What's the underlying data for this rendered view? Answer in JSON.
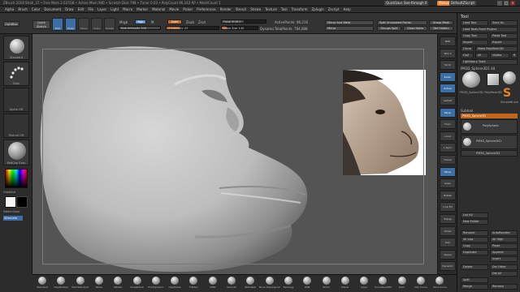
{
  "titlebar": {
    "title": "ZBrush 2018   Stroll_37  • Free Mem 2.637GB • Active Mem 940 • Scratch Disk 798 • Timer 0.03 • PolyCount 96.163 KP • MeshCount 1",
    "quicksave": "QuickSave",
    "seethrough": "See-through  0",
    "menus_btn": "Menus",
    "default_script": "DefaultZScript"
  },
  "menubar": [
    "Alpha",
    "Brush",
    "Color",
    "Document",
    "Draw",
    "Edit",
    "File",
    "Layer",
    "Light",
    "Macro",
    "Marker",
    "Material",
    "Movie",
    "Picker",
    "Preferences",
    "Render",
    "Stencil",
    "Stroke",
    "Texture",
    "Tool",
    "Transform",
    "Zplugin",
    "Zscript",
    "Help"
  ],
  "topshelf": {
    "lightbox": "LightBox",
    "quick_sketch": "Quick Sketch",
    "edit": "Edit",
    "draw": "Draw",
    "move": "Move",
    "scale": "Scale",
    "rotate": "Rotate",
    "mrgb": "Mrgb",
    "rgb": "Rgb",
    "m": "M",
    "rgb_intensity": "Rgb Intensity 100",
    "rgb_intensity_level": 1,
    "zadd": "Zadd",
    "zsub": "Zsub",
    "zcut": "Zcut",
    "z_intensity": "Z Intensity 25",
    "z_intensity_level": 0.25,
    "focal_shift": "Focal Shift 0",
    "focal_shift_level": 0.5,
    "draw_size": "Draw Size 140",
    "draw_size_level": 0.14,
    "dynamic": "Dynamic",
    "active_points": "ActivePoints: 96,216",
    "total_points": "TotalPoints: 784,088",
    "mirror_weld": "Mirror And Weld",
    "mirror": "Mirror",
    "split_unmasked": "Split Unmasked Points",
    "groups_split": "Groups Split",
    "close_holes": "Close Holes",
    "del_hidden": "Del Hidden",
    "cursor_readout": "Group Mask",
    "extra": "Append"
  },
  "leftshelf": {
    "brush_cap": "Standard",
    "stroke_cap": "Dots",
    "alpha_cap": "Alpha Off",
    "texture_cap": "Texture Off",
    "material_cap": "MatCap Gray",
    "gradient": "Gradient",
    "switch_color": "SwitchColor",
    "alternate": "Alternate"
  },
  "righttray": [
    "BPR",
    "SPix 3",
    "Scroll",
    "Zoom",
    "Actual",
    "AAHalf",
    "Persp",
    "Floor",
    "Local",
    "L.Sym",
    "Frame",
    "Move",
    "Scale",
    "Rotate",
    "Line Fill",
    "Transp",
    "Ghost",
    "Solo",
    "Xpose",
    "Dynamic"
  ],
  "toolpanel": {
    "header": "Tool",
    "load_tool": "Load Tool",
    "save_as": "Save As",
    "load_project": "Load Tools From Project",
    "copy_tool": "Copy Tool",
    "paste_tool": "Paste Tool",
    "import": "Import",
    "export": "Export",
    "clone": "Clone",
    "make_polymesh": "Make PolyMesh3D",
    "goz": "GoZ",
    "all": "All",
    "visible": "Visible",
    "r": "R",
    "lightbox_tools": "Lightbox ▸ Tools",
    "current_tool": "PM3D_Sphere3D1  48",
    "tool_count": "48",
    "thumb1": "PM3D_Sphere3D",
    "thumb2": "PolyMesh3D",
    "thumb3": "SimpleBrush",
    "subtool": "Subtool",
    "subtool_item1": "PM3D_Sphere3D",
    "subtool_item2": "PolySphere",
    "subtool_item3": "PM3D_Sphere3D1",
    "subtool_item4": "PM3D_Sphere3D",
    "list_all": "List All",
    "new_folder": "New Folder",
    "rename": "Rename",
    "auto_reorder": "AutoReorder",
    "all_low": "All Low",
    "all_high": "All High",
    "copy": "Copy",
    "paste": "Paste",
    "duplicate": "Duplicate",
    "append": "Append",
    "insert": "Insert",
    "delete": "Delete",
    "del_other": "Del Other",
    "del_all": "Del All",
    "split": "Split",
    "merge": "Merge",
    "remesh": "Remesh"
  },
  "bottomshelf": {
    "brushes": [
      "Standard",
      "ClayBuildup",
      "DamStandard",
      "Move",
      "hPolish",
      "SnakeHook",
      "TrimDynamic",
      "ClayTubes",
      "Flatten",
      "Inflat",
      "Smooth",
      "ZModeler",
      "Move Topological",
      "Topology",
      "IMM",
      "Pinch",
      "Planar",
      "Layer",
      "CurveQuadFill",
      "Dam",
      "Clip Curve",
      "Slice Curve"
    ]
  },
  "canvas": {
    "reference_image": "chimpanzee-profile-photo"
  },
  "colors": {
    "accent_orange": "#e8822a",
    "active_blue": "#3b6fa5",
    "canvas_gray": "#545454",
    "clay_gray": "#c8c8c8"
  }
}
